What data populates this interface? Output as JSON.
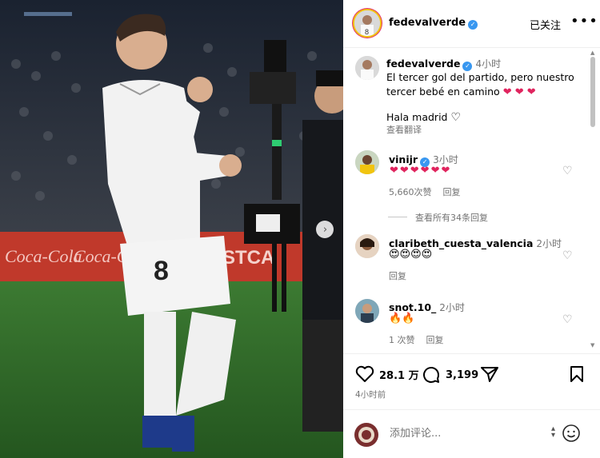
{
  "post": {
    "username": "fedevalverde",
    "follow_label": "已关注",
    "more_label": "•••",
    "next_label": "›",
    "caption": {
      "time": "4小时",
      "line1": "El tercer gol del partido, pero nuestro",
      "line2": "tercer bebé en camino",
      "hearts": "❤ ❤ ❤",
      "line3": "Hala madrid",
      "see_translation": "查看翻译"
    },
    "likes": "28.1 万",
    "comments_count": "3,199",
    "posted_time": "4小时前"
  },
  "comments": [
    {
      "username": "vinijr",
      "verified": true,
      "time": "3小时",
      "text": "❤❤❤❤❤❤",
      "likes": "5,660次赞",
      "reply": "回复",
      "view_replies": "查看所有34条回复"
    },
    {
      "username": "claribeth_cuesta_valencia",
      "time": "2小时",
      "text": "😍😍😍😍",
      "reply": "回复"
    },
    {
      "username": "snot.10_",
      "time": "2小时",
      "text": "🔥🔥",
      "likes": "1 次赞",
      "reply": "回复"
    }
  ],
  "comment_box": {
    "placeholder": "添加评论..."
  },
  "photo": {
    "banner_text_left": "Coca-Cola",
    "banner_text_right": "ESTCA",
    "jersey_number": "8"
  },
  "colors": {
    "verified": "#3897f0",
    "heart": "#e0245e",
    "pitch": "#2e6b2a",
    "banner": "#c0392b"
  }
}
